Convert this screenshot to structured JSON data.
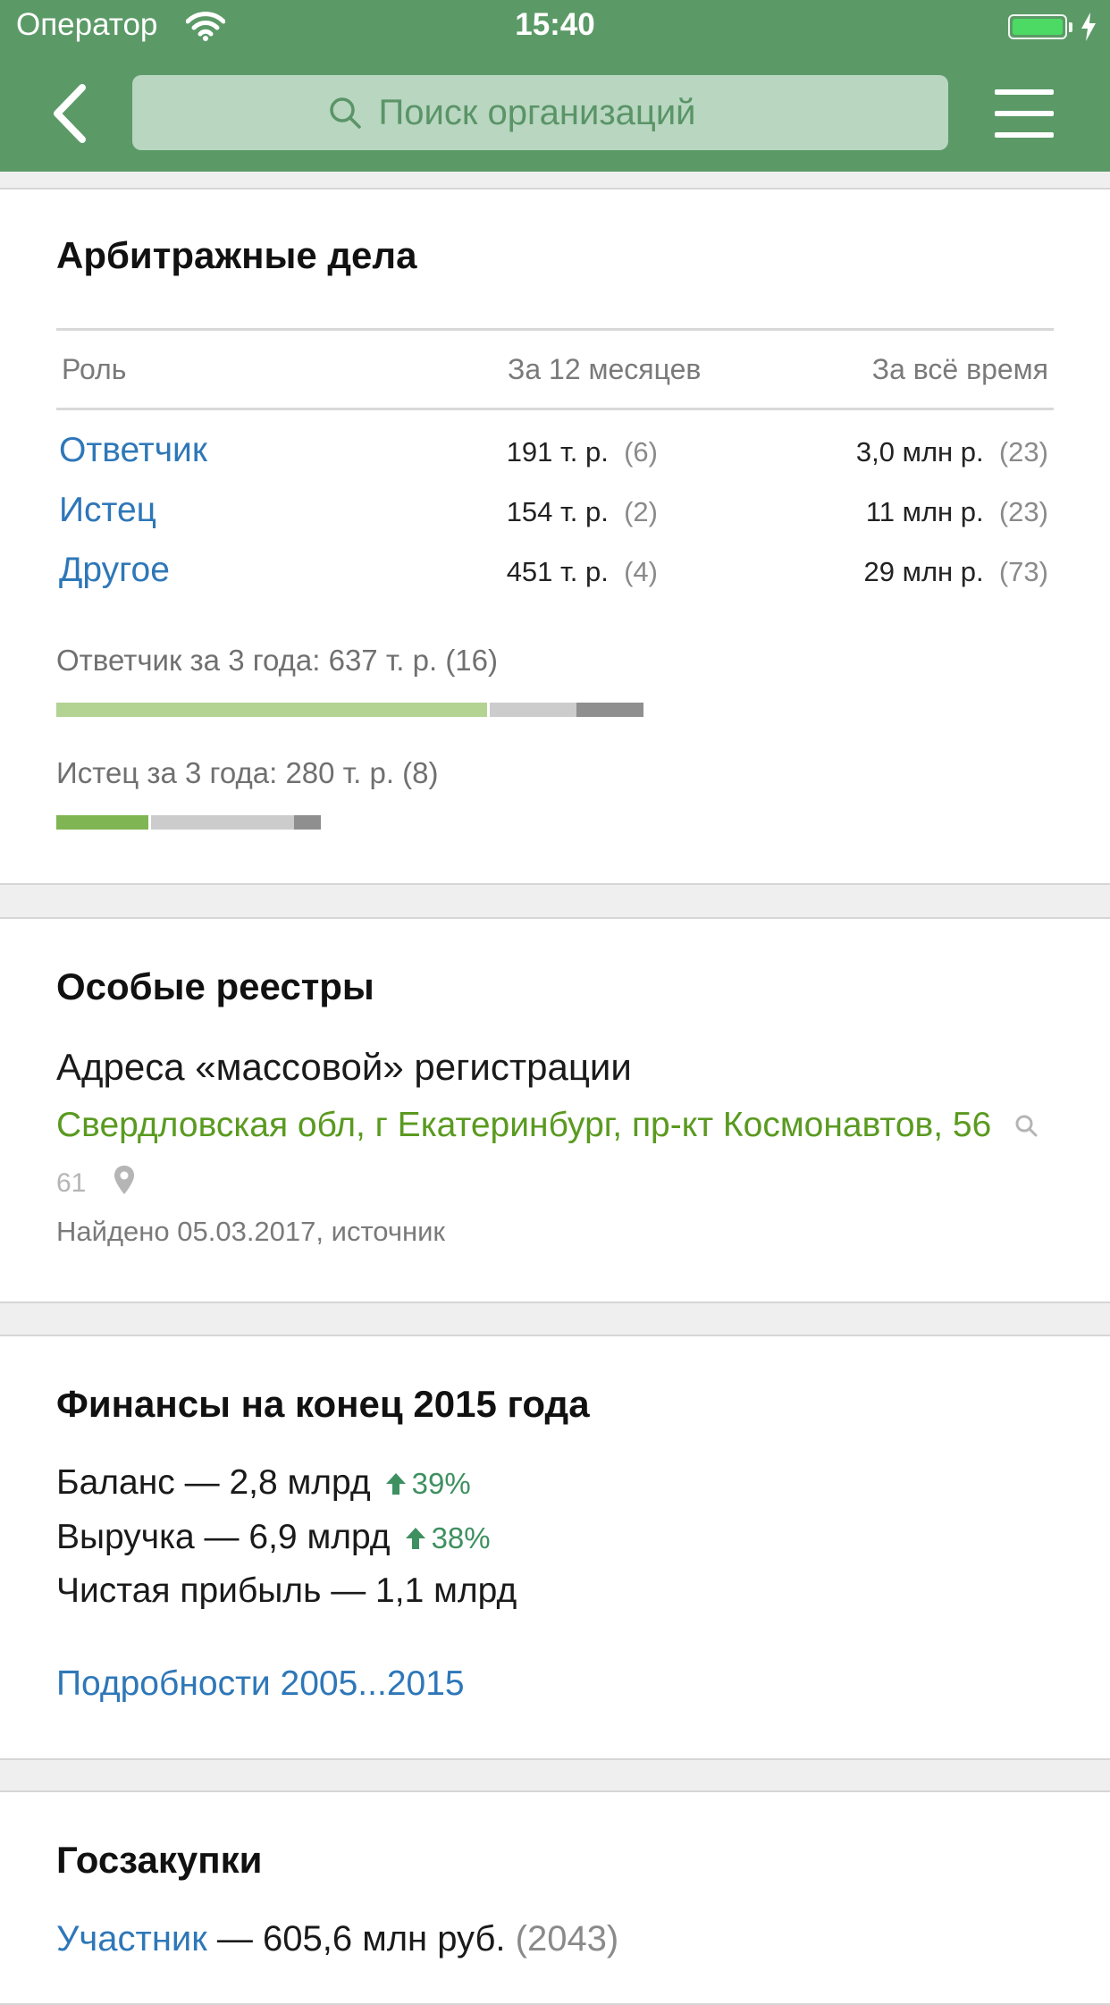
{
  "status_bar": {
    "carrier": "Оператор",
    "time": "15:40"
  },
  "header": {
    "search_placeholder": "Поиск организаций"
  },
  "arbitration": {
    "title": "Арбитражные дела",
    "col_role": "Роль",
    "col_12m": "За 12 месяцев",
    "col_all": "За всё время",
    "rows": [
      {
        "role": "Ответчик",
        "m12_sum": "191 т. р.",
        "m12_count": "(6)",
        "all_sum": "3,0 млн р.",
        "all_count": "(23)"
      },
      {
        "role": "Истец",
        "m12_sum": "154 т. р.",
        "m12_count": "(2)",
        "all_sum": "11 млн р.",
        "all_count": "(23)"
      },
      {
        "role": "Другое",
        "m12_sum": "451 т. р.",
        "m12_count": "(4)",
        "all_sum": "29 млн р.",
        "all_count": "(73)"
      }
    ],
    "defendant_summary": "Ответчик за 3 года: 637 т. р. (16)",
    "plaintiff_summary": "Истец за 3 года: 280 т. р. (8)",
    "colors": {
      "light_green": "#b3d393",
      "green": "#7fb552",
      "light_gray": "#cccccc",
      "dark_gray": "#8f8f8f"
    }
  },
  "registry": {
    "title": "Особые реестры",
    "heading": "Адреса «массовой» регистрации",
    "address": "Свердловская обл, г Екатеринбург, пр-кт Космонавтов, 56",
    "search_count": "61",
    "found_text": "Найдено 05.03.2017, источник"
  },
  "finance": {
    "title": "Финансы на конец 2015 года",
    "balance": "Баланс — 2,8 млрд",
    "balance_change": "39%",
    "revenue": "Выручка — 6,9 млрд",
    "revenue_change": "38%",
    "profit": "Чистая прибыль — 1,1 млрд",
    "details_link": "Подробности 2005...2015"
  },
  "procurement": {
    "title": "Госзакупки",
    "participant_link": "Участник",
    "participant_value": " — 605,6 млн руб. ",
    "participant_count": "(2043)"
  }
}
